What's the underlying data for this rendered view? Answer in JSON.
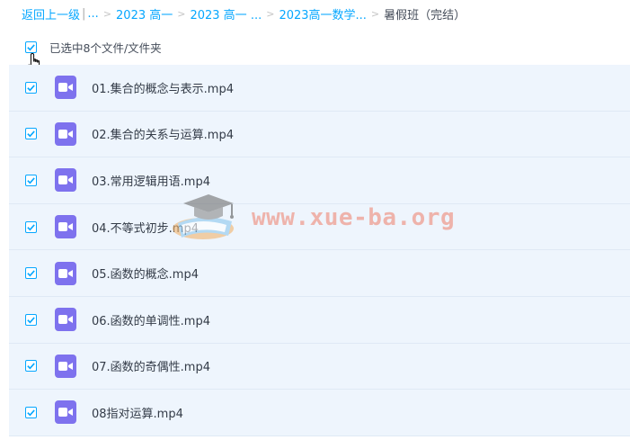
{
  "breadcrumb": {
    "back": "返回上一级",
    "bar": "|",
    "ellipsis": "...",
    "items": [
      "2023 高一",
      "2023 高一 ...",
      "2023高一数学..."
    ],
    "current": "暑假班（完结）"
  },
  "selection": {
    "text": "已选中8个文件/文件夹"
  },
  "files": [
    {
      "name": "01.集合的概念与表示.mp4",
      "checked": true
    },
    {
      "name": "02.集合的关系与运算.mp4",
      "checked": true
    },
    {
      "name": "03.常用逻辑用语.mp4",
      "checked": true
    },
    {
      "name": "04.不等式初步.mp4",
      "checked": true
    },
    {
      "name": "05.函数的概念.mp4",
      "checked": true
    },
    {
      "name": "06.函数的单调性.mp4",
      "checked": true
    },
    {
      "name": "07.函数的奇偶性.mp4",
      "checked": true
    },
    {
      "name": "08指对运算.mp4",
      "checked": true
    }
  ],
  "watermark": {
    "text": "www.xue-ba.org"
  },
  "colors": {
    "accent": "#06a7ff",
    "video_icon": "#7e72ee",
    "row_bg": "#eef5fd",
    "watermark": "#ee7c68"
  }
}
